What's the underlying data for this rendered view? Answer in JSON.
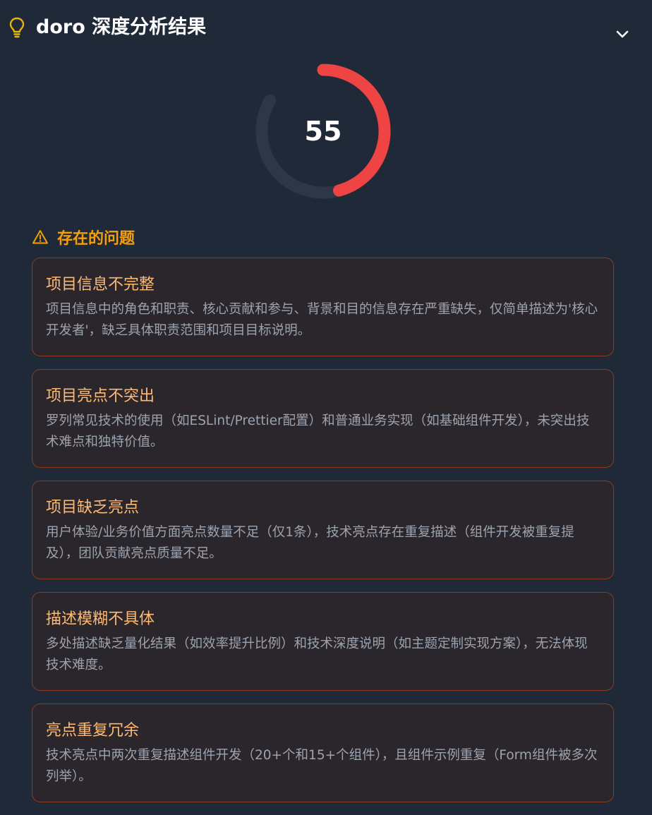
{
  "header": {
    "title": "doro 深度分析结果",
    "icon": "lightbulb-icon",
    "collapse_icon": "chevron-down-icon",
    "accent_color": "#eab308"
  },
  "score": {
    "value": "55",
    "fraction": 0.55,
    "arc_color": "#ef4444",
    "track_color": "#2d3748"
  },
  "issues_section": {
    "title": "存在的问题",
    "icon": "warning-icon",
    "accent_color": "#f59e0b"
  },
  "issues": [
    {
      "title": "项目信息不完整",
      "desc": "项目信息中的角色和职责、核心贡献和参与、背景和目的信息存在严重缺失，仅简单描述为'核心开发者'，缺乏具体职责范围和项目目标说明。"
    },
    {
      "title": "项目亮点不突出",
      "desc": "罗列常见技术的使用（如ESLint/Prettier配置）和普通业务实现（如基础组件开发），未突出技术难点和独特价值。"
    },
    {
      "title": "项目缺乏亮点",
      "desc": "用户体验/业务价值方面亮点数量不足（仅1条），技术亮点存在重复描述（组件开发被重复提及），团队贡献亮点质量不足。"
    },
    {
      "title": "描述模糊不具体",
      "desc": "多处描述缺乏量化结果（如效率提升比例）和技术深度说明（如主题定制实现方案），无法体现技术难度。"
    },
    {
      "title": "亮点重复冗余",
      "desc": "技术亮点中两次重复描述组件开发（20+个和15+个组件），且组件示例重复（Form组件被多次列举）。"
    }
  ]
}
